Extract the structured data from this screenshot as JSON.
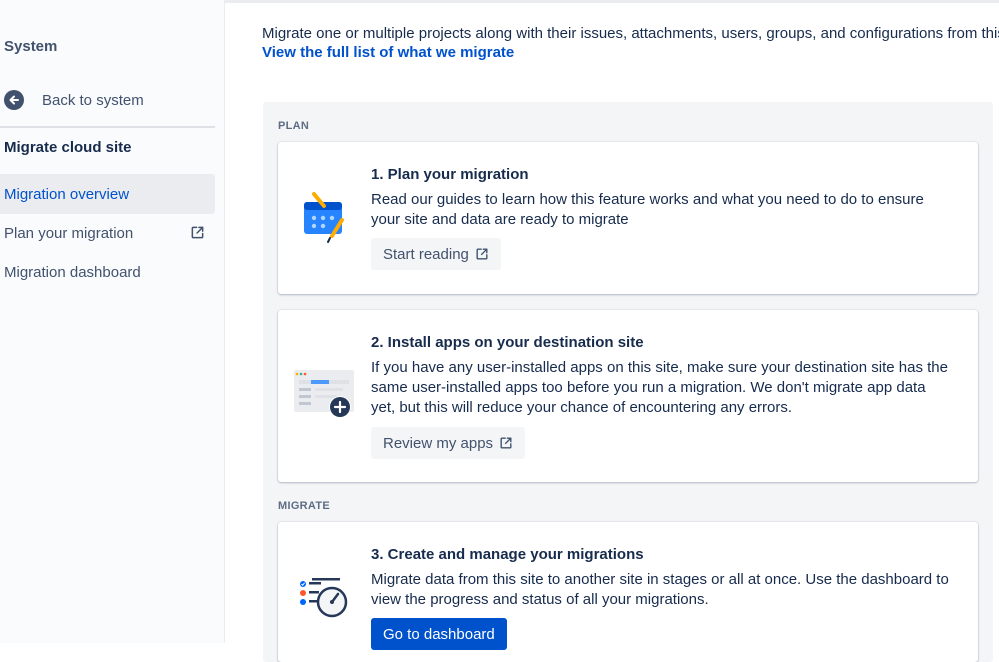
{
  "sidebar": {
    "title": "System",
    "back_label": "Back to system",
    "section_title": "Migrate cloud site",
    "items": [
      {
        "label": "Migration overview",
        "active": true
      },
      {
        "label": "Plan your migration",
        "external": true
      },
      {
        "label": "Migration dashboard"
      }
    ]
  },
  "main": {
    "intro": "Migrate one or multiple projects along with their issues, attachments, users, groups, and configurations from this site",
    "intro_link": "View the full list of what we migrate",
    "sections": {
      "plan": "PLAN",
      "migrate": "MIGRATE"
    },
    "cards": [
      {
        "title": "1. Plan your migration",
        "text": "Read our guides to learn how this feature works and what you need to do to ensure your site and data are ready to migrate",
        "button": "Start reading",
        "icon": "guide-illustration-icon"
      },
      {
        "title": "2. Install apps on your destination site",
        "text": "If you have any user-installed apps on this site, make sure your destination site has the same user-installed apps too before you run a migration. We don't migrate app data yet, but this will reduce your chance of encountering any errors.",
        "button": "Review my apps",
        "icon": "apps-illustration-icon"
      },
      {
        "title": "3. Create and manage your migrations",
        "text": "Migrate data from this site to another site in stages or all at once. Use the dashboard to view the progress and status of all your migrations.",
        "button": "Go to dashboard",
        "icon": "dashboard-illustration-icon"
      }
    ]
  },
  "colors": {
    "accent": "#0052cc",
    "text": "#172b4d",
    "subtle": "#42526e",
    "panel": "#f4f5f7"
  }
}
